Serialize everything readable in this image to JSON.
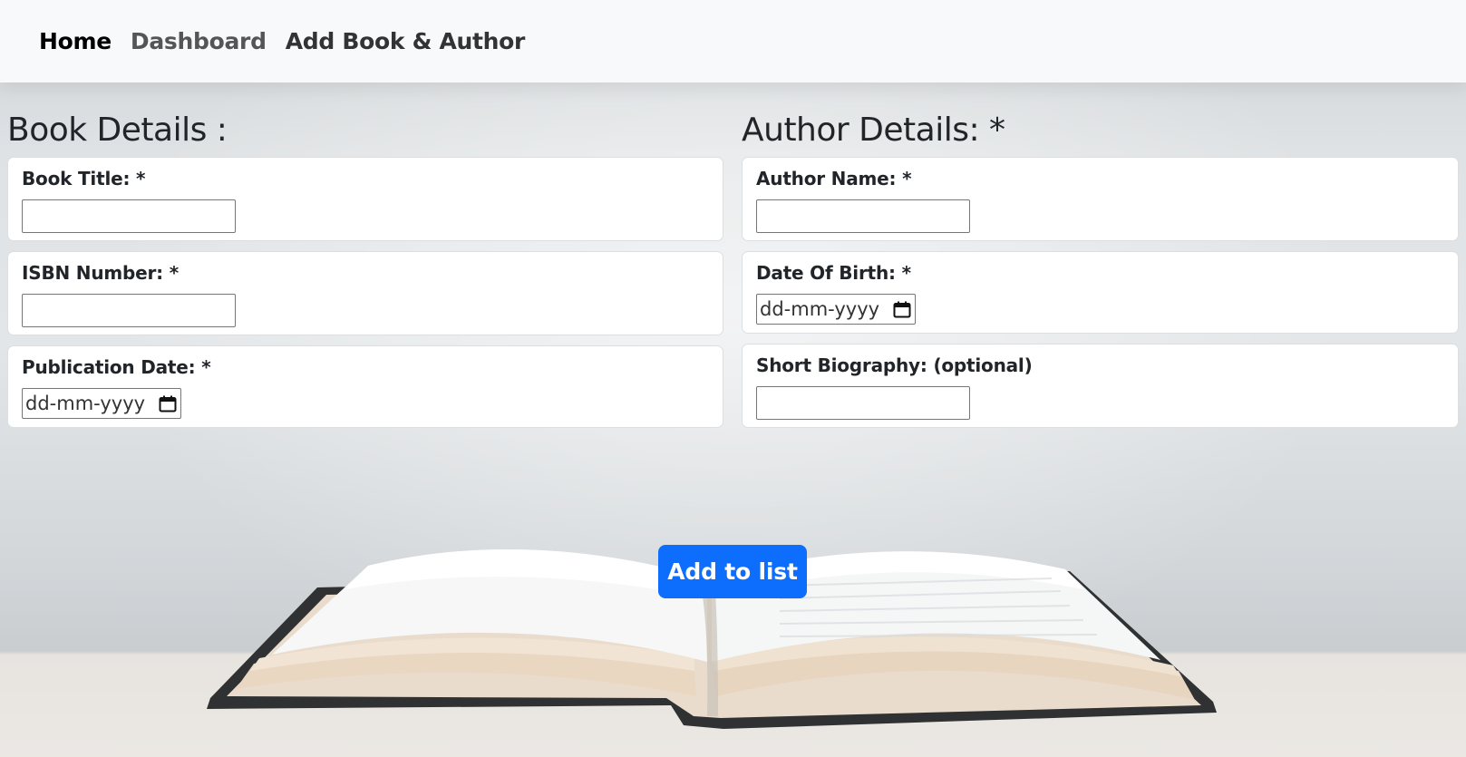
{
  "nav": {
    "home": "Home",
    "dashboard": "Dashboard",
    "add_book_author": "Add Book & Author"
  },
  "book_section": {
    "title": "Book Details :",
    "fields": {
      "book_title_label": "Book Title: *",
      "isbn_label": "ISBN Number: *",
      "publication_date_label": "Publication Date: *",
      "publication_date_placeholder": "dd-mm-yyyy"
    }
  },
  "author_section": {
    "title": "Author Details: *",
    "fields": {
      "author_name_label": "Author Name: *",
      "dob_label": "Date Of Birth: *",
      "dob_placeholder": "dd-mm-yyyy",
      "bio_label": "Short Biography: (optional)"
    }
  },
  "actions": {
    "add_to_list": "Add to list"
  },
  "colors": {
    "primary_button": "#0d6efd",
    "navbar_bg": "#f8f9fa"
  }
}
